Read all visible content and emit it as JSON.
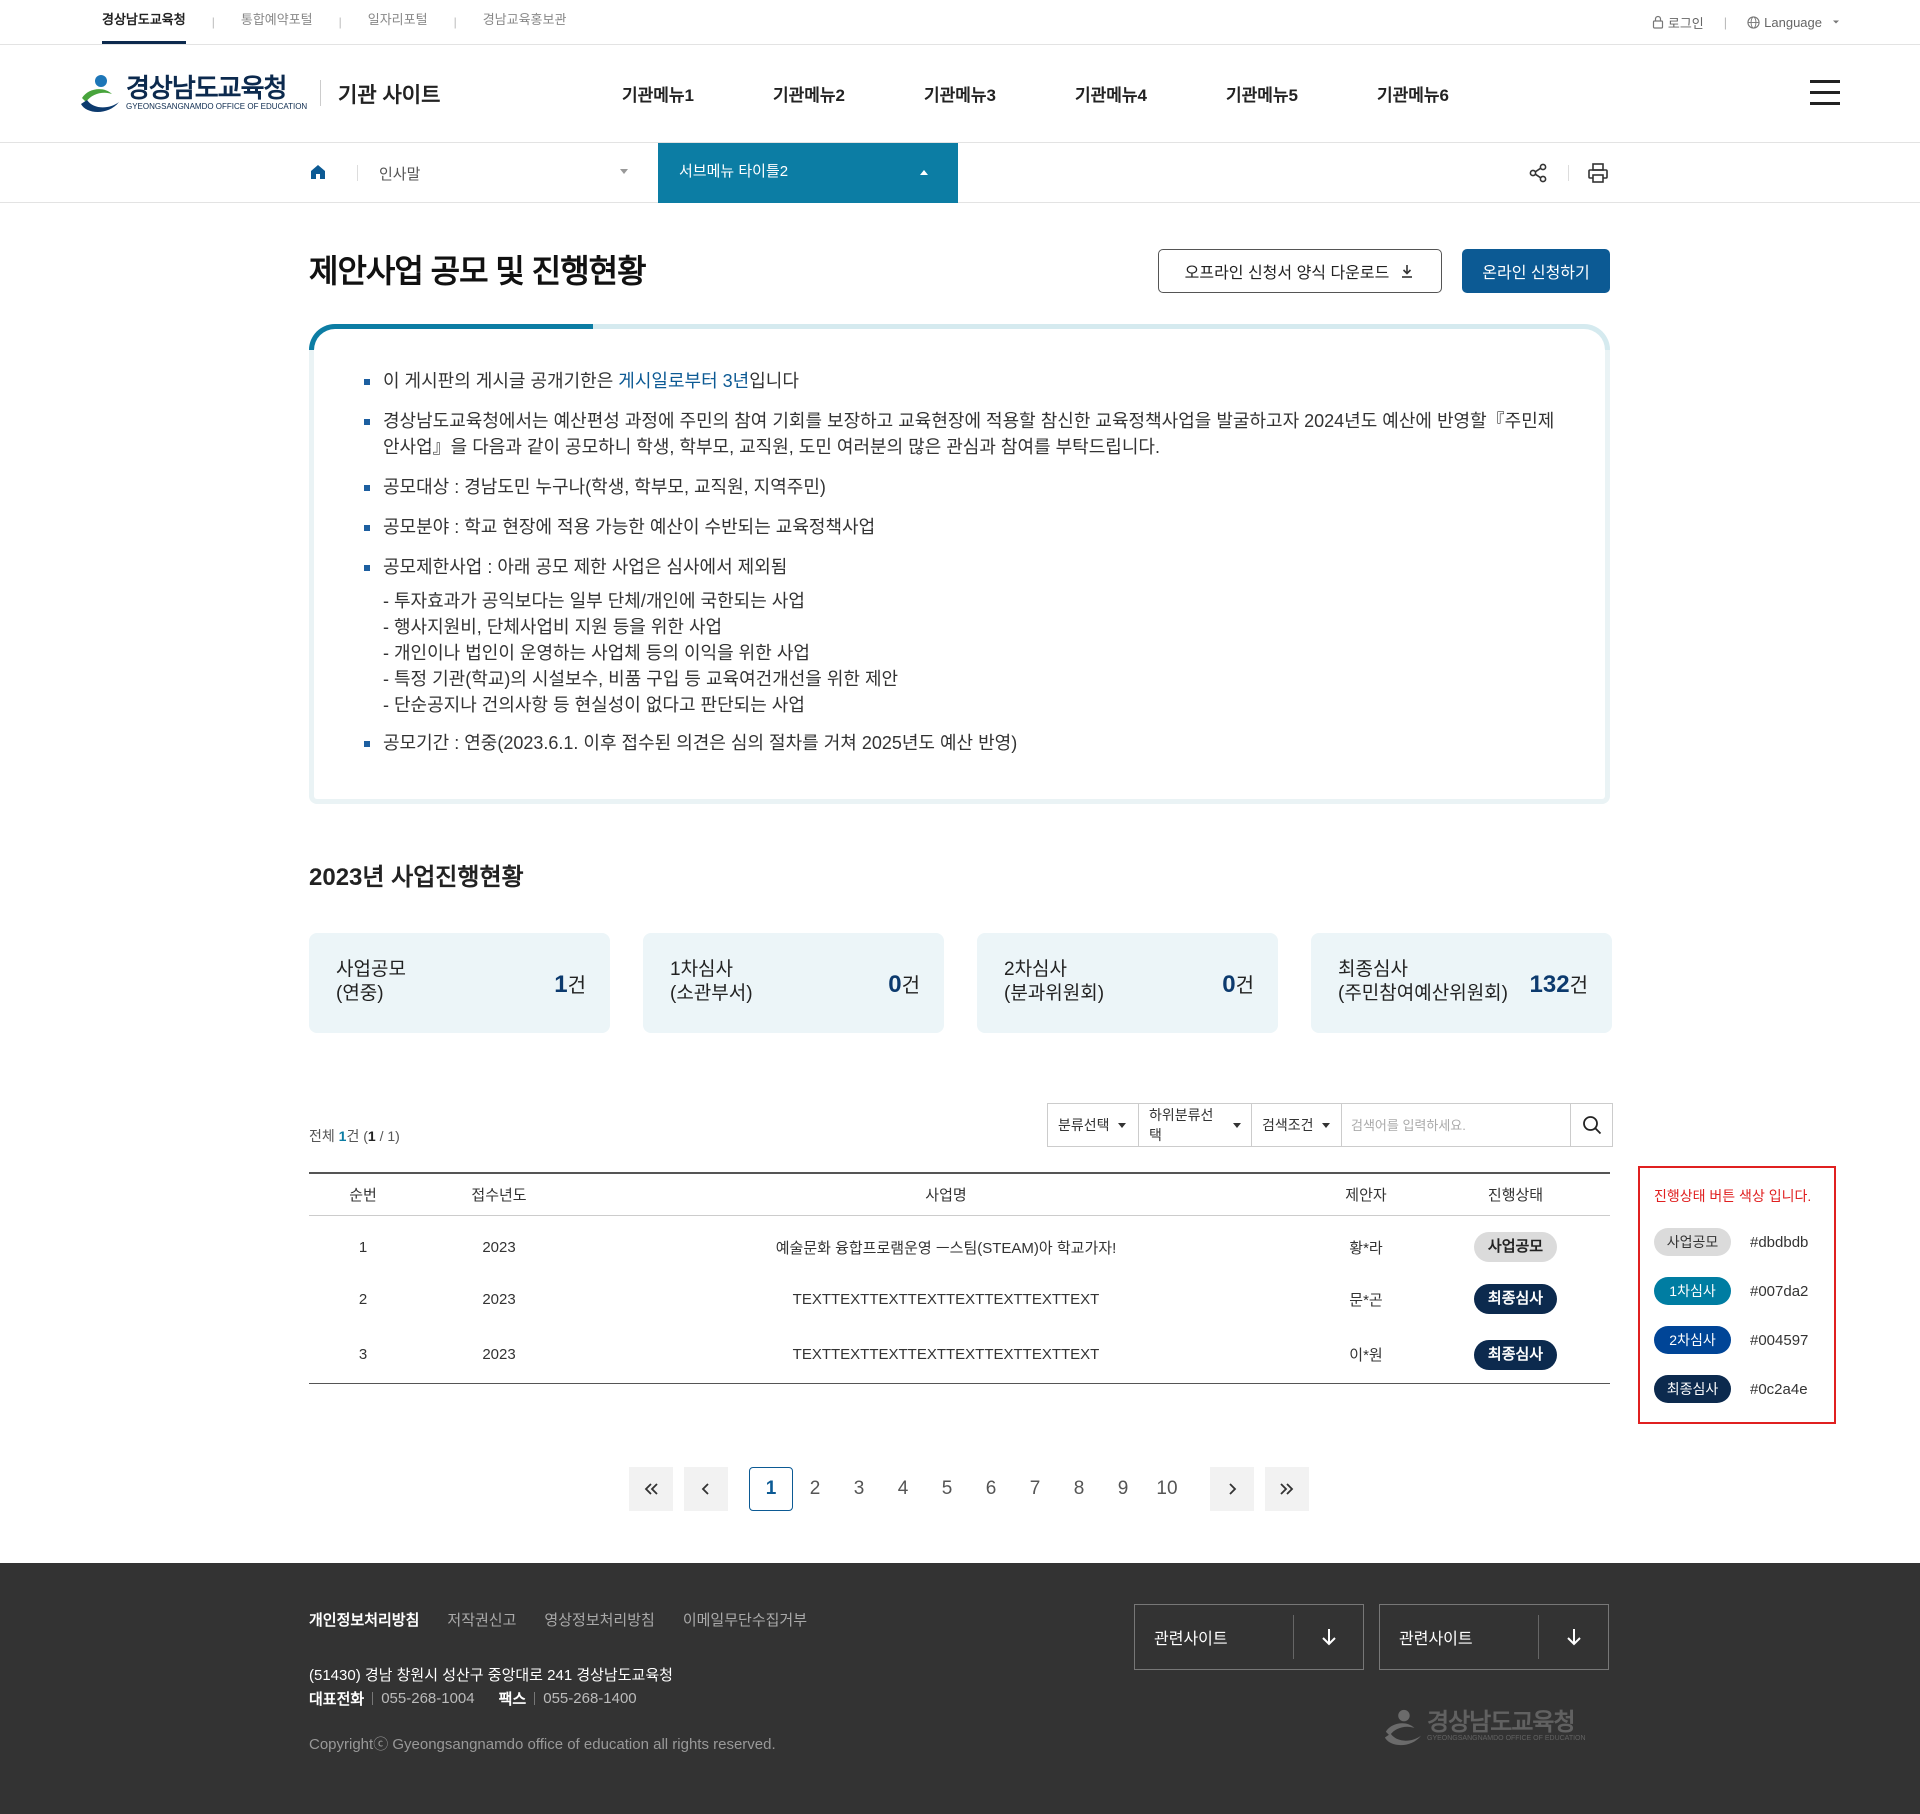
{
  "utility": {
    "links": [
      "경상남도교육청",
      "통합예약포털",
      "일자리포털",
      "경남교육홍보관"
    ],
    "login": "로그인",
    "language": "Language"
  },
  "header": {
    "logo_ko": "경상남도교육청",
    "logo_en": "GYEONGSANGNAMDO OFFICE OF EDUCATION",
    "site_name": "기관 사이트",
    "menu": [
      "기관메뉴1",
      "기관메뉴2",
      "기관메뉴3",
      "기관메뉴4",
      "기관메뉴5",
      "기관메뉴6"
    ]
  },
  "location": {
    "depth1": "인사말",
    "depth2": "서브메뉴 타이틀2"
  },
  "page": {
    "title": "제안사업 공모 및 진행현황",
    "download_label": "오프라인 신청서 양식 다운로드",
    "online_label": "온라인 신청하기"
  },
  "info": {
    "item1_pre": "이 게시판의 게시글 공개기한은 ",
    "item1_hl": "게시일로부터 3년",
    "item1_post": "입니다",
    "item2": "경상남도교육청에서는 예산편성 과정에 주민의 참여 기회를 보장하고 교육현장에 적용할 참신한 교육정책사업을 발굴하고자 2024년도 예산에 반영할『주민제안사업』을 다음과 같이 공모하니 학생, 학부모, 교직원, 도민 여러분의 많은 관심과 참여를 부탁드립니다.",
    "item3": "공모대상 : 경남도민 누구나(학생, 학부모, 교직원, 지역주민)",
    "item4": "공모분야 : 학교 현장에 적용 가능한 예산이 수반되는 교육정책사업",
    "item5": "공모제한사업 : 아래 공모 제한 사업은 심사에서 제외됨",
    "sub": [
      "- 투자효과가 공익보다는 일부 단체/개인에 국한되는 사업",
      "- 행사지원비, 단체사업비 지원 등을 위한 사업",
      "- 개인이나 법인이 운영하는 사업체 등의 이익을 위한 사업",
      "- 특정 기관(학교)의 시설보수, 비품 구입 등 교육여건개선을 위한 제안",
      "- 단순공지나 건의사항 등 현실성이 없다고 판단되는 사업"
    ],
    "item6": "공모기간 : 연중(2023.6.1. 이후 접수된 의견은 심의 절차를 거쳐 2025년도 예산 반영)"
  },
  "stats": {
    "title": "2023년 사업진행현황",
    "unit": "건",
    "cards": [
      {
        "line1": "사업공모",
        "line2": "(연중)",
        "count": "1"
      },
      {
        "line1": "1차심사",
        "line2": "(소관부서)",
        "count": "0"
      },
      {
        "line1": "2차심사",
        "line2": "(분과위원회)",
        "count": "0"
      },
      {
        "line1": "최종심사",
        "line2": "(주민참여예산위원회)",
        "count": "132"
      }
    ]
  },
  "board": {
    "total_prefix": "전체 ",
    "total_count": "1",
    "total_suffix": "건 (",
    "page_current": "1",
    "page_sep": " / 1)",
    "filters": [
      "분류선택",
      "하위분류선택",
      "검색조건"
    ],
    "search_placeholder": "검색어를 입력하세요.",
    "columns": [
      "순번",
      "접수년도",
      "사업명",
      "제안자",
      "진행상태"
    ],
    "rows": [
      {
        "no": "1",
        "year": "2023",
        "title": "예술문화 융합프로램운영 ㅡ스팀(STEAM)아 학교가자!",
        "author": "황*라",
        "status": "사업공모"
      },
      {
        "no": "2",
        "year": "2023",
        "title": "TEXTTEXTTEXTTEXTTEXTTEXTTEXTTEXT",
        "author": "문*곤",
        "status": "최종심사"
      },
      {
        "no": "3",
        "year": "2023",
        "title": "TEXTTEXTTEXTTEXTTEXTTEXTTEXTTEXT",
        "author": "이*원",
        "status": "최종심사"
      }
    ]
  },
  "pagination": {
    "pages": [
      "1",
      "2",
      "3",
      "4",
      "5",
      "6",
      "7",
      "8",
      "9",
      "10"
    ],
    "current": "1"
  },
  "legend": {
    "title": "진행상태 버튼 색상 입니다.",
    "items": [
      {
        "label": "사업공모",
        "hex": "#dbdbdb"
      },
      {
        "label": "1차심사",
        "hex": "#007da2"
      },
      {
        "label": "2차심사",
        "hex": "#004597"
      },
      {
        "label": "최종심사",
        "hex": "#0c2a4e"
      }
    ]
  },
  "footer": {
    "links": [
      "개인정보처리방침",
      "저작권신고",
      "영상정보처리방침",
      "이메일무단수집거부"
    ],
    "address": "(51430) 경남 창원시 성산구 중앙대로 241 경상남도교육청",
    "tel_label": "대표전화",
    "tel": "055-268-1004",
    "fax_label": "팩스",
    "fax": "055-268-1400",
    "copyright": "Copyrightⓒ Gyeongsangnamdo office of education all rights reserved.",
    "related1": "관련사이트",
    "related2": "관련사이트"
  },
  "colors": {
    "primary": "#0c5a94",
    "accent": "#0c7da4",
    "navy": "#0c2a4e",
    "legend_border": "#e02020"
  }
}
